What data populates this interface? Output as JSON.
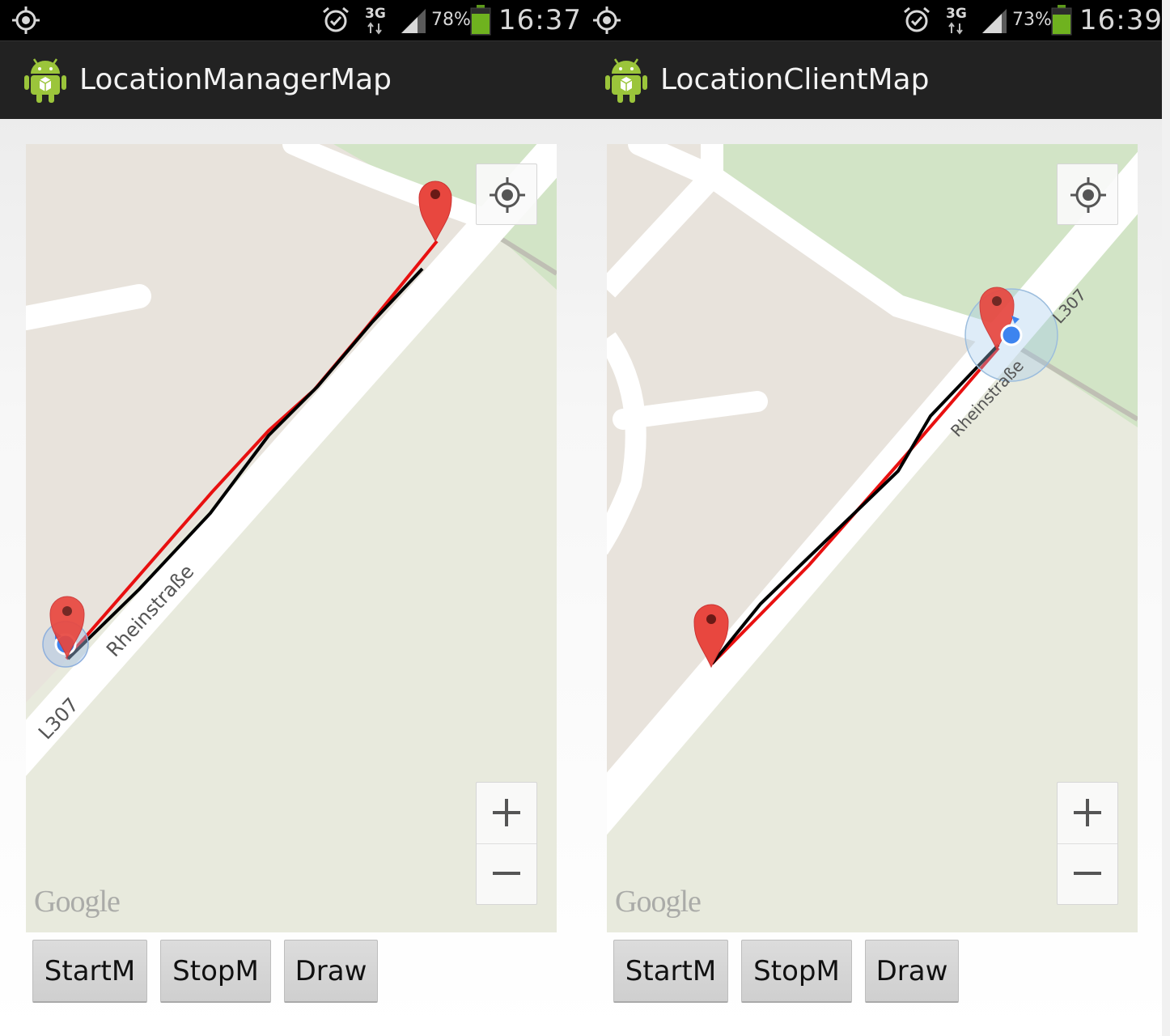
{
  "screens": [
    {
      "status": {
        "network": "3G",
        "battery_pct": "78%",
        "time": "16:37"
      },
      "app_title": "LocationManagerMap",
      "map": {
        "street_name": "Rheinstraße",
        "road_ref": "L307",
        "attribution": "Google"
      },
      "buttons": {
        "start": "StartM",
        "stop": "StopM",
        "draw": "Draw"
      }
    },
    {
      "status": {
        "network": "3G",
        "battery_pct": "73%",
        "time": "16:39"
      },
      "app_title": "LocationClientMap",
      "map": {
        "street_name": "Rheinstraße",
        "road_ref": "L307",
        "attribution": "Google"
      },
      "buttons": {
        "start": "StartM",
        "stop": "StopM",
        "draw": "Draw"
      }
    }
  ],
  "colors": {
    "track_red": "#e81010",
    "track_black": "#000000",
    "marker_red": "#e8473f",
    "location_dot": "#3d84ef",
    "park_green": "#d2e4c6",
    "land_beige": "#e8e3dc",
    "land_pale": "#e8eadd"
  },
  "icons": [
    "gps-icon",
    "alarm-icon",
    "signal-icon",
    "battery-icon",
    "android-app-icon",
    "my-location-icon",
    "zoom-in-icon",
    "zoom-out-icon",
    "map-marker-icon",
    "current-location-icon"
  ]
}
